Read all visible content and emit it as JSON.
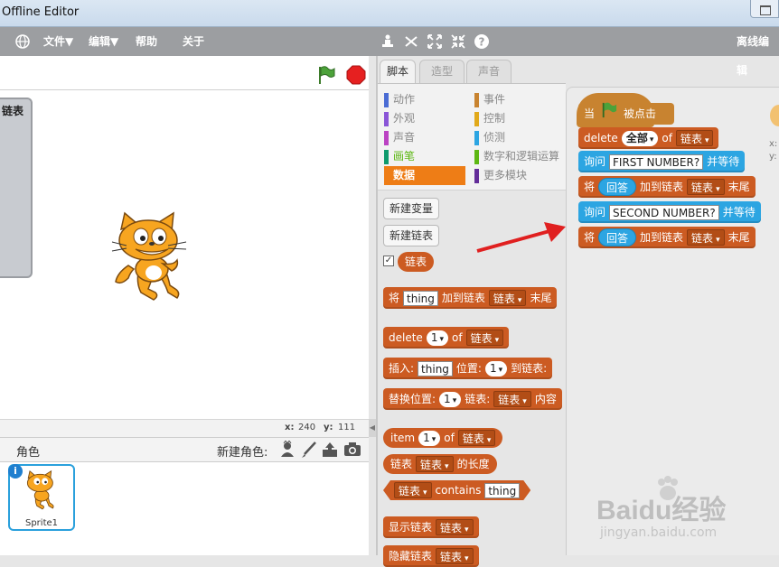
{
  "window": {
    "title": "Offline Editor"
  },
  "menu": {
    "file": "文件▼",
    "edit": "编辑▼",
    "help": "帮助",
    "about": "关于",
    "right_title": "离线编辑"
  },
  "stage": {
    "monitor_label": "链表",
    "coord_x_label": "x:",
    "coord_x": "240",
    "coord_y_label": "y:",
    "coord_y": "111"
  },
  "sprites": {
    "header": "角色",
    "new_sprite_label": "新建角色:",
    "items": [
      {
        "name": "Sprite1"
      }
    ]
  },
  "tabs": [
    "脚本",
    "造型",
    "声音"
  ],
  "categories": {
    "left": [
      {
        "label": "动作",
        "color": "#4a6cd4"
      },
      {
        "label": "外观",
        "color": "#8a55d7"
      },
      {
        "label": "声音",
        "color": "#bb42c3"
      },
      {
        "label": "画笔",
        "color": "#0e9a6c"
      },
      {
        "label": "数据",
        "color": "#ee7d16"
      }
    ],
    "right": [
      {
        "label": "事件",
        "color": "#c88330"
      },
      {
        "label": "控制",
        "color": "#e1a91a"
      },
      {
        "label": "侦测",
        "color": "#2ca5e2"
      },
      {
        "label": "数字和逻辑运算",
        "color": "#5cb712"
      },
      {
        "label": "更多模块",
        "color": "#632d99"
      }
    ],
    "selected": "数据"
  },
  "palette": {
    "new_variable": "新建变量",
    "new_list": "新建链表",
    "list_name": "链表",
    "add_block": {
      "verb": "将",
      "item": "thing",
      "middle": "加到链表",
      "list": "链表",
      "tail": "末尾"
    },
    "delete_block": {
      "verb": "delete",
      "index": "1",
      "of": "of",
      "list": "链表"
    },
    "insert_block": {
      "verb": "插入:",
      "item": "thing",
      "pos": "位置:",
      "index": "1",
      "to": "到链表:"
    },
    "replace_block": {
      "verb": "替换位置:",
      "index": "1",
      "list_label": "链表:",
      "list": "链表",
      "tail": "内容"
    },
    "item_block": {
      "verb": "item",
      "index": "1",
      "of": "of",
      "list": "链表"
    },
    "length_block": {
      "list": "链表",
      "list_drop": "链表",
      "tail": "的长度"
    },
    "contains_block": {
      "list": "链表",
      "verb": "contains",
      "item": "thing"
    },
    "show_block": {
      "verb": "显示链表",
      "list": "链表"
    },
    "hide_block": {
      "verb": "隐藏链表",
      "list": "链表"
    }
  },
  "script": {
    "hat": {
      "when": "当",
      "clicked": "被点击"
    },
    "delete": {
      "verb": "delete",
      "which": "全部",
      "of": "of",
      "list": "链表"
    },
    "ask1": {
      "verb": "询问",
      "question": "FIRST NUMBER?",
      "tail": "并等待"
    },
    "add1": {
      "verb": "将",
      "answer": "回答",
      "middle": "加到链表",
      "list": "链表",
      "tail": "末尾"
    },
    "ask2": {
      "verb": "询问",
      "question": "SECOND NUMBER?",
      "tail": "并等待"
    },
    "add2": {
      "verb": "将",
      "answer": "回答",
      "middle": "加到链表",
      "list": "链表",
      "tail": "末尾"
    },
    "sprite_info": {
      "x": "x:",
      "y": "y:"
    }
  },
  "watermark": {
    "brand": "Baidu经验",
    "url": "jingyan.baidu.com"
  },
  "colors": {
    "list_block": "#cc5b22",
    "sensing_block": "#2ca5e2",
    "event_block": "#c88330",
    "menubar": "#9c9ea1",
    "arrow": "#e02020"
  }
}
